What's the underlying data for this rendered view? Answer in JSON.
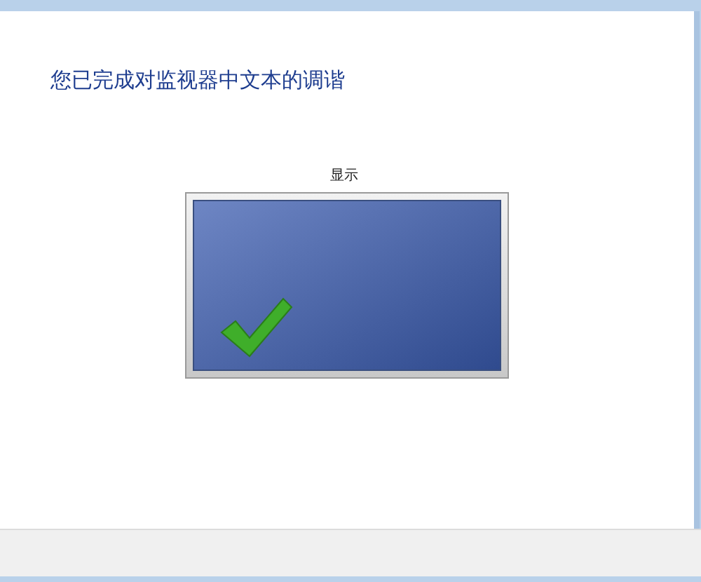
{
  "heading": "您已完成对监视器中文本的调谐",
  "monitor": {
    "label": "显示"
  }
}
